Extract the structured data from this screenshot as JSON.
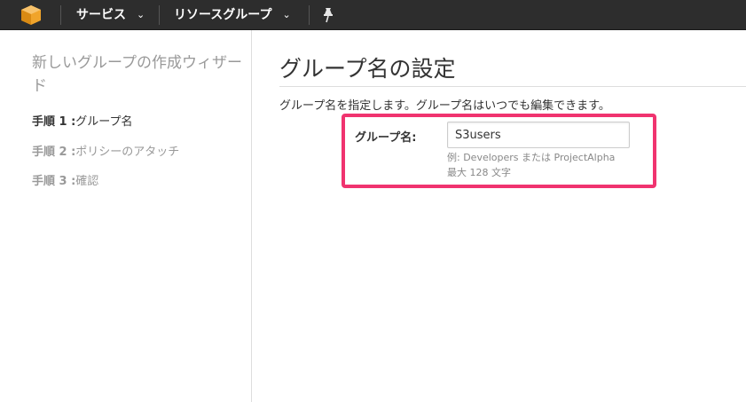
{
  "nav": {
    "logo_icon": "aws-cube-icon",
    "services_label": "サービス",
    "resource_groups_label": "リソースグループ",
    "chevron": "⌄",
    "pin_icon": "pin-icon",
    "background_color": "#2d2d2d",
    "logo_color": "#f0a42b"
  },
  "sidebar": {
    "wizard_title": "新しいグループの作成ウィザード",
    "steps": [
      {
        "number": "手順 1 :",
        "label": "グループ名",
        "active": true
      },
      {
        "number": "手順 2 :",
        "label": "ポリシーのアタッチ",
        "active": false
      },
      {
        "number": "手順 3 :",
        "label": "確認",
        "active": false
      }
    ]
  },
  "main": {
    "title": "グループ名の設定",
    "description": "グループ名を指定します。グループ名はいつでも編集できます。",
    "field_label": "グループ名:",
    "field_value": "S3users",
    "hint_example": "例: Developers または ProjectAlpha",
    "hint_max": "最大 128 文字",
    "highlight_color": "#f0336f"
  }
}
